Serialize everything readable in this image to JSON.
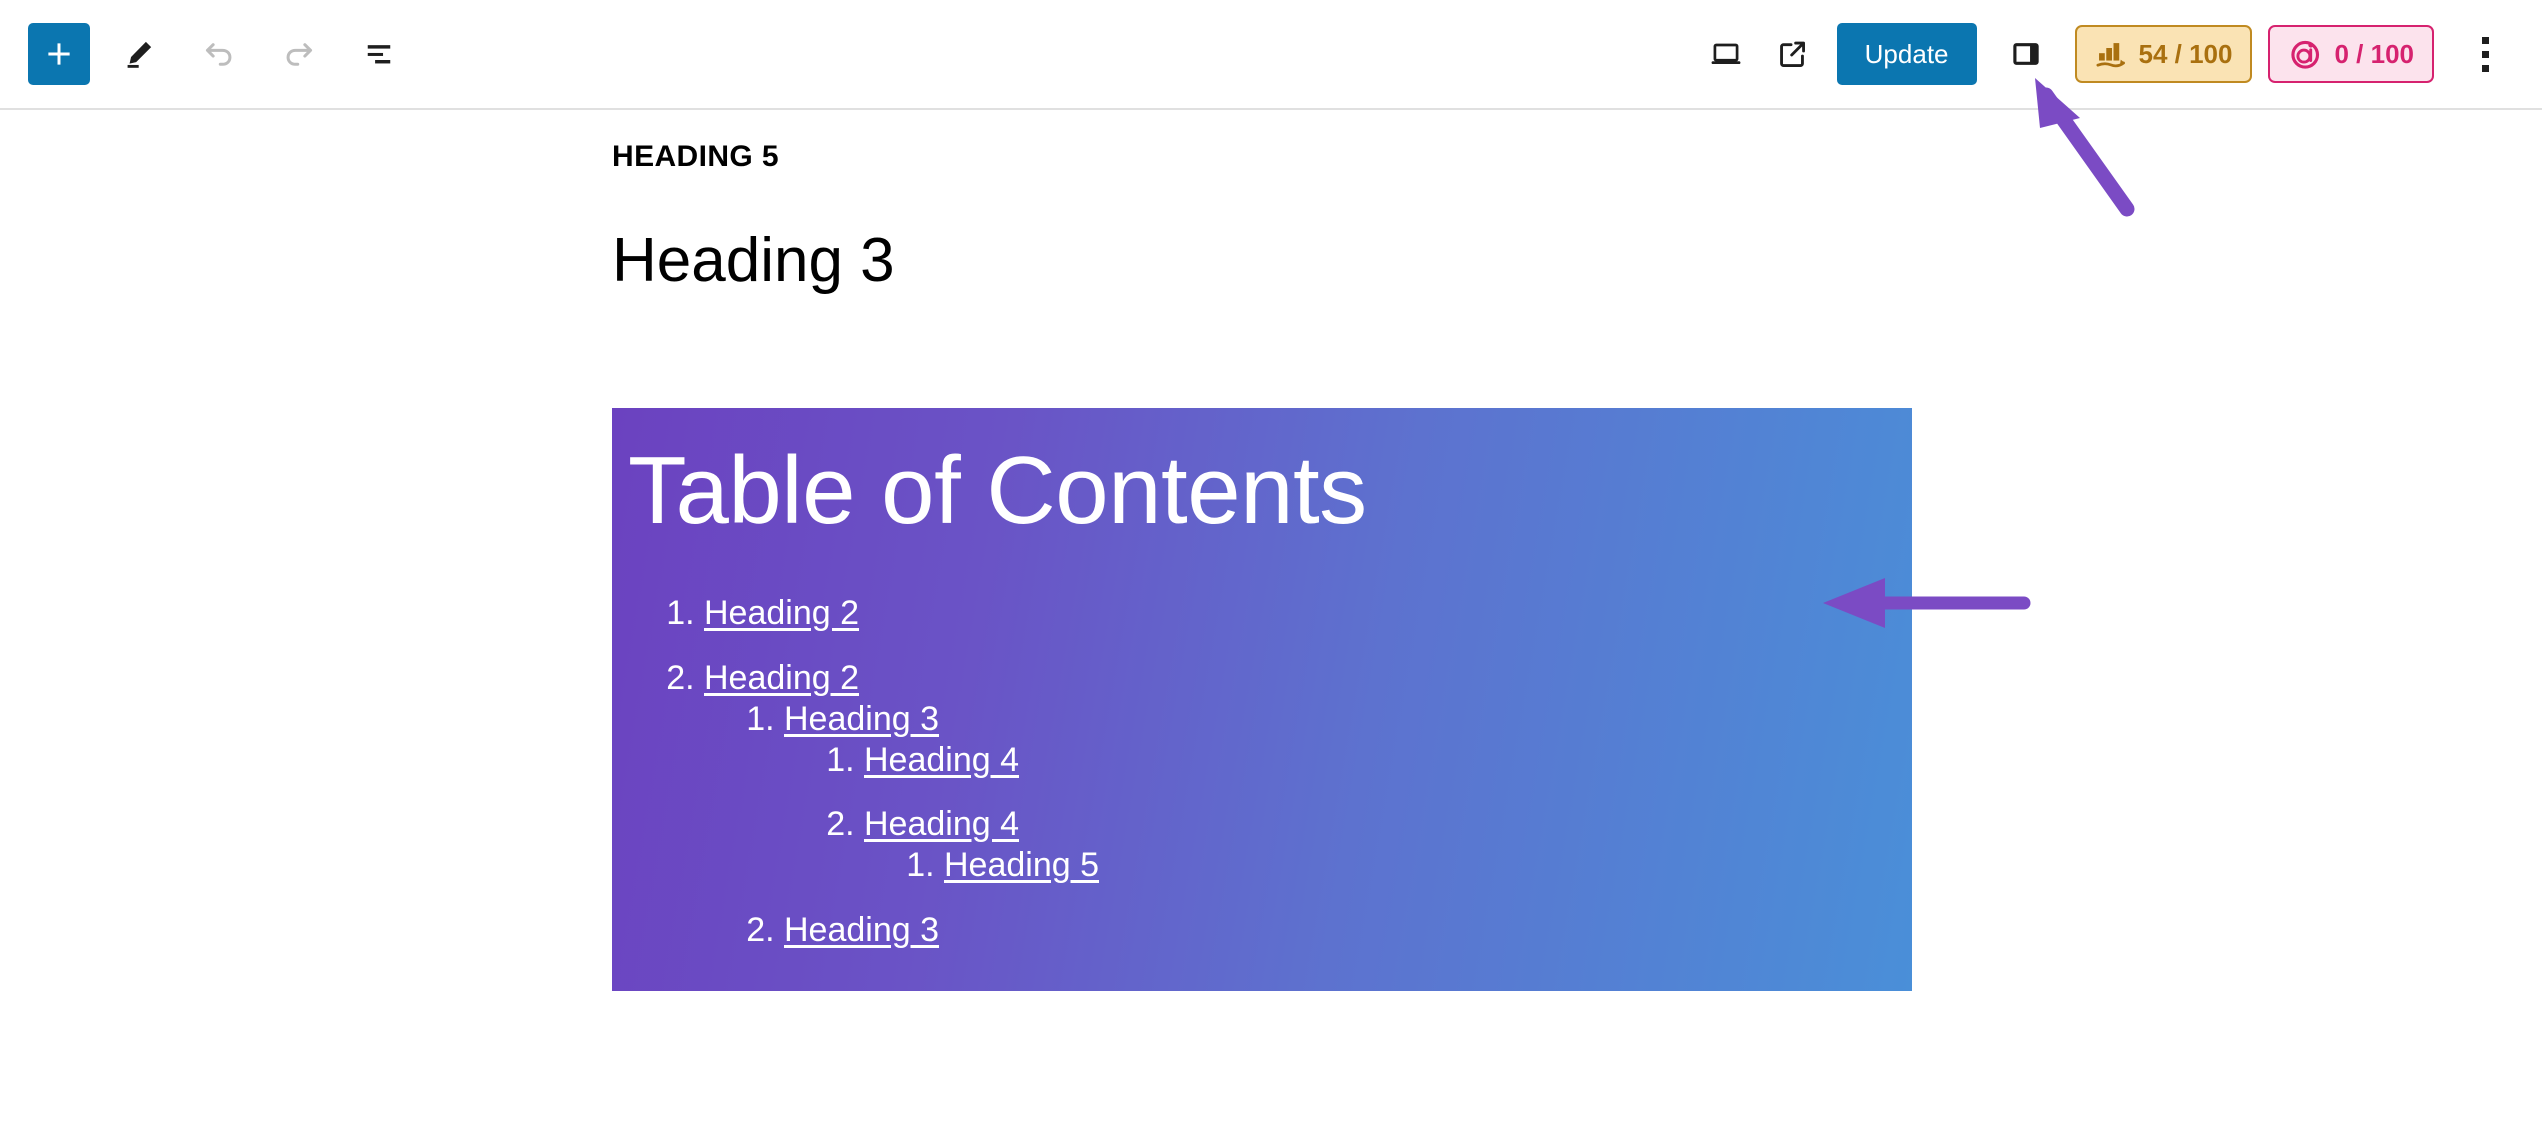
{
  "header": {
    "left_tools": [
      {
        "name": "block-inserter",
        "icon": "plus-icon",
        "label": "Toggle block inserter"
      },
      {
        "name": "tools-edit",
        "icon": "pencil-icon",
        "label": "Edit"
      },
      {
        "name": "undo",
        "icon": "undo-arrow-icon",
        "label": "Undo"
      },
      {
        "name": "redo",
        "icon": "redo-arrow-icon",
        "label": "Redo"
      },
      {
        "name": "list-view",
        "icon": "list-view-icon",
        "label": "Document Overview"
      }
    ],
    "preview_label": "Preview",
    "view_post_label": "View Post",
    "update_label": "Update",
    "settings_sidebar_label": "Settings",
    "options_label": "Options",
    "badges": [
      {
        "name": "seo-score-badge",
        "icon": "bar-chart-icon",
        "value": "54 / 100",
        "score": 54,
        "max": 100,
        "background": "#fae3b4",
        "border": "#c08a21",
        "text_color": "#a9700f"
      },
      {
        "name": "ai-score-badge",
        "icon": "ai-circle-icon",
        "value": "0 / 100",
        "score": 0,
        "max": 100,
        "background": "#fce3ed",
        "border": "#d6226f",
        "text_color": "#d6226f"
      }
    ],
    "accent_color": "#0b76b0"
  },
  "content": {
    "heading_5": "HEADING 5",
    "heading_3": "Heading 3",
    "toc_block": {
      "title": "Table of Contents",
      "gradient_start": "#6b42c0",
      "gradient_end": "#4a8fd8",
      "items": [
        {
          "index": "1",
          "label": "Heading 2",
          "level": 1
        },
        {
          "index": "2",
          "label": "Heading 2",
          "level": 1
        },
        {
          "index": "1",
          "label": "Heading 3",
          "level": 2
        },
        {
          "index": "1",
          "label": "Heading 4",
          "level": 3
        },
        {
          "index": "2",
          "label": "Heading 4",
          "level": 3
        },
        {
          "index": "1",
          "label": "Heading 5",
          "level": 4
        },
        {
          "index": "2",
          "label": "Heading 3",
          "level": 2
        }
      ]
    }
  },
  "annotations": {
    "color": "#7b4bc4",
    "arrow_sidebar_target": "settings-sidebar-toggle",
    "arrow_block_target": "table-of-contents-block"
  }
}
